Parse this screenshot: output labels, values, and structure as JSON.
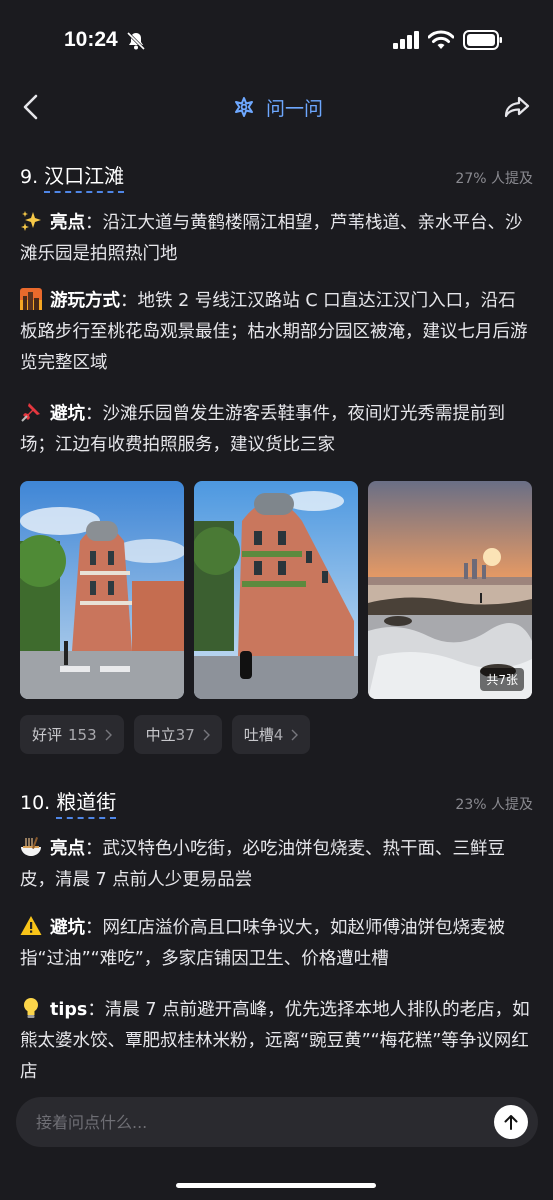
{
  "status": {
    "time": "10:24"
  },
  "nav": {
    "title": "问一问"
  },
  "sections": [
    {
      "number": "9.",
      "name": "汉口江滩",
      "percent": "27% 人提及",
      "paras": [
        {
          "emoji": "sparkles-emoji",
          "label": "亮点",
          "text": "：沿江大道与黄鹤楼隔江相望，芦苇栈道、亲水平台、沙滩乐园是拍照热门地"
        },
        {
          "emoji": "cityscape-emoji",
          "label": "游玩方式",
          "text": "：地铁 2 号线江汉路站 C 口直达江汉门入口，沿石板路步行至桃花岛观景最佳；枯水期部分园区被淹，建议七月后游览完整区域"
        },
        {
          "emoji": "pushpin-emoji",
          "label": "避坑",
          "text": "：沙滩乐园曾发生游客丢鞋事件，夜间灯光秀需提前到场；江边有收费拍照服务，建议货比三家"
        }
      ],
      "photo_count": "共7张",
      "chips": [
        {
          "label": "好评",
          "count": "153"
        },
        {
          "label": "中立",
          "count": "37"
        },
        {
          "label": "吐槽",
          "count": "4"
        }
      ]
    },
    {
      "number": "10.",
      "name": "粮道街",
      "percent": "23% 人提及",
      "paras": [
        {
          "emoji": "noodle-bowl-emoji",
          "label": "亮点",
          "text": "：武汉特色小吃街，必吃油饼包烧麦、热干面、三鲜豆皮，清晨 7 点前人少更易品尝"
        },
        {
          "emoji": "warning-emoji",
          "label": "避坑",
          "text": "：网红店溢价高且口味争议大，如赵师傅油饼包烧麦被指“过油”“难吃”，多家店铺因卫生、价格遭吐槽"
        },
        {
          "emoji": "lightbulb-emoji",
          "label": "tips",
          "text": "：清晨 7 点前避开高峰，优先选择本地人排队的老店，如熊太婆水饺、覃肥叔桂林米粉，远离“豌豆黄”“梅花糕”等争议网红店"
        }
      ]
    }
  ],
  "input": {
    "placeholder": "接着问点什么..."
  },
  "colors": {
    "accent": "#6ea8ff",
    "background": "#1b1b1f",
    "chip": "#2a2a2f"
  }
}
